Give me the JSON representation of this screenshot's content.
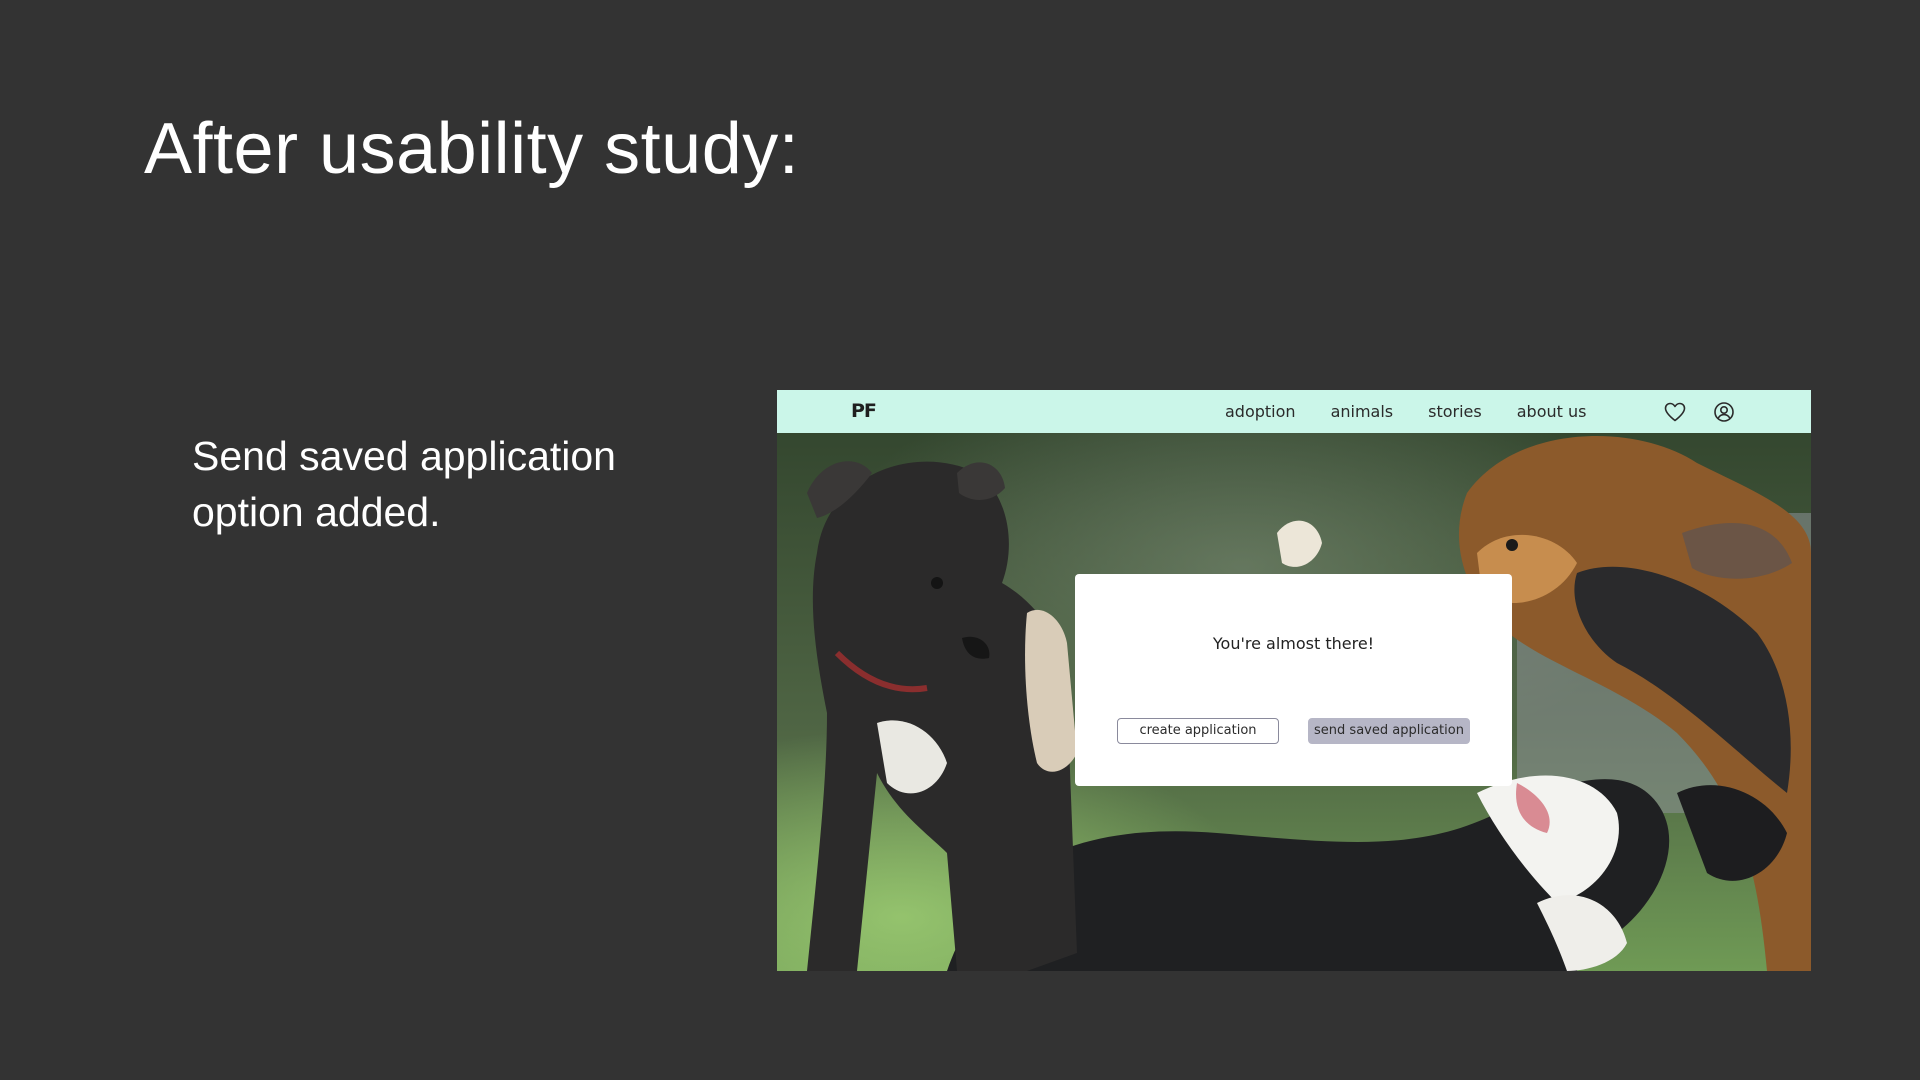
{
  "slide": {
    "title": "After usability study:",
    "note": "Send saved application option added."
  },
  "nav": {
    "logo": "PF",
    "links": [
      "adoption",
      "animals",
      "stories",
      "about us"
    ],
    "icons": [
      "heart-icon",
      "user-account-icon"
    ],
    "background_color": "#cbf6e9"
  },
  "hero": {
    "image": "dogs-playing-photo"
  },
  "modal": {
    "message": "You're almost there!",
    "create_button": "create application",
    "send_button": "send saved application"
  },
  "colors": {
    "slide_background": "#333333",
    "send_button": "#b6b6c6"
  }
}
